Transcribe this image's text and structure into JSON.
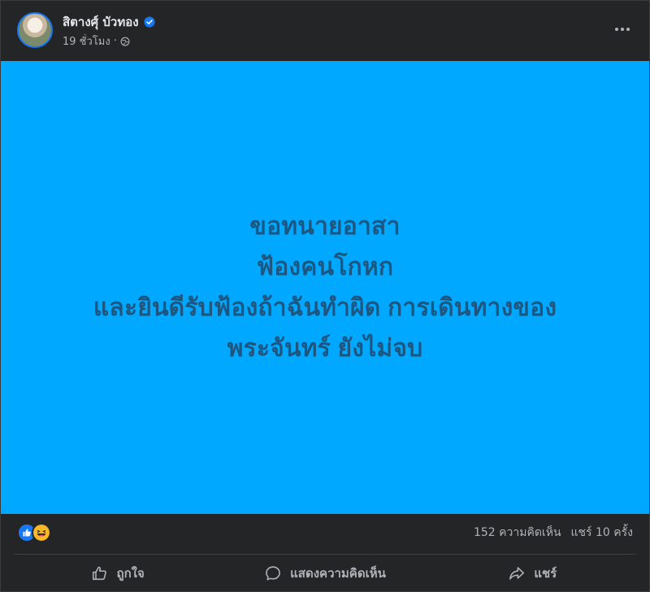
{
  "post": {
    "author_name": "สิตางศุ์ บัวทอง",
    "timestamp": "19 ชั่วโมง",
    "separator": "·",
    "privacy_icon": "globe-icon",
    "verified_icon": "verified-badge-icon",
    "more_icon": "more-options-icon",
    "background_color": "#00a9ff",
    "text_color": "#1f567f",
    "text_lines": [
      "ขอทนายอาสา",
      "ฟ้องคนโกหก",
      "และยินดีรับฟ้องถ้าฉันทำผิด การเดินทางของ",
      "พระจันทร์ ยังไม่จบ"
    ]
  },
  "stats": {
    "reaction_icons": [
      "like-reaction-icon",
      "haha-reaction-icon"
    ],
    "comments": "152 ความคิดเห็น",
    "shares": "แชร์ 10 ครั้ง"
  },
  "actions": {
    "like_label": "ถูกใจ",
    "comment_label": "แสดงความคิดเห็น",
    "share_label": "แชร์"
  },
  "colors": {
    "card_bg": "#242526",
    "page_bg": "#18191a",
    "primary_text": "#e4e6eb",
    "secondary_text": "#b0b3b8",
    "accent": "#1877f2"
  }
}
